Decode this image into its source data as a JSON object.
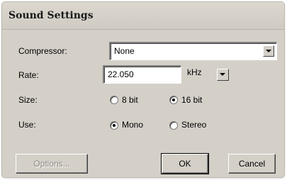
{
  "dialog": {
    "title": "Sound Settings"
  },
  "compressor": {
    "label": "Compressor:",
    "value": "None"
  },
  "rate": {
    "label": "Rate:",
    "value": "22.050",
    "unit": "kHz"
  },
  "size": {
    "label": "Size:",
    "options": [
      "8 bit",
      "16 bit"
    ],
    "selected": "16 bit"
  },
  "use": {
    "label": "Use:",
    "options": [
      "Mono",
      "Stereo"
    ],
    "selected": "Mono"
  },
  "buttons": {
    "options": "Options...",
    "ok": "OK",
    "cancel": "Cancel"
  },
  "colors": {
    "dialog_bg": "#d4d0c8",
    "field_bg": "#ffffff"
  }
}
